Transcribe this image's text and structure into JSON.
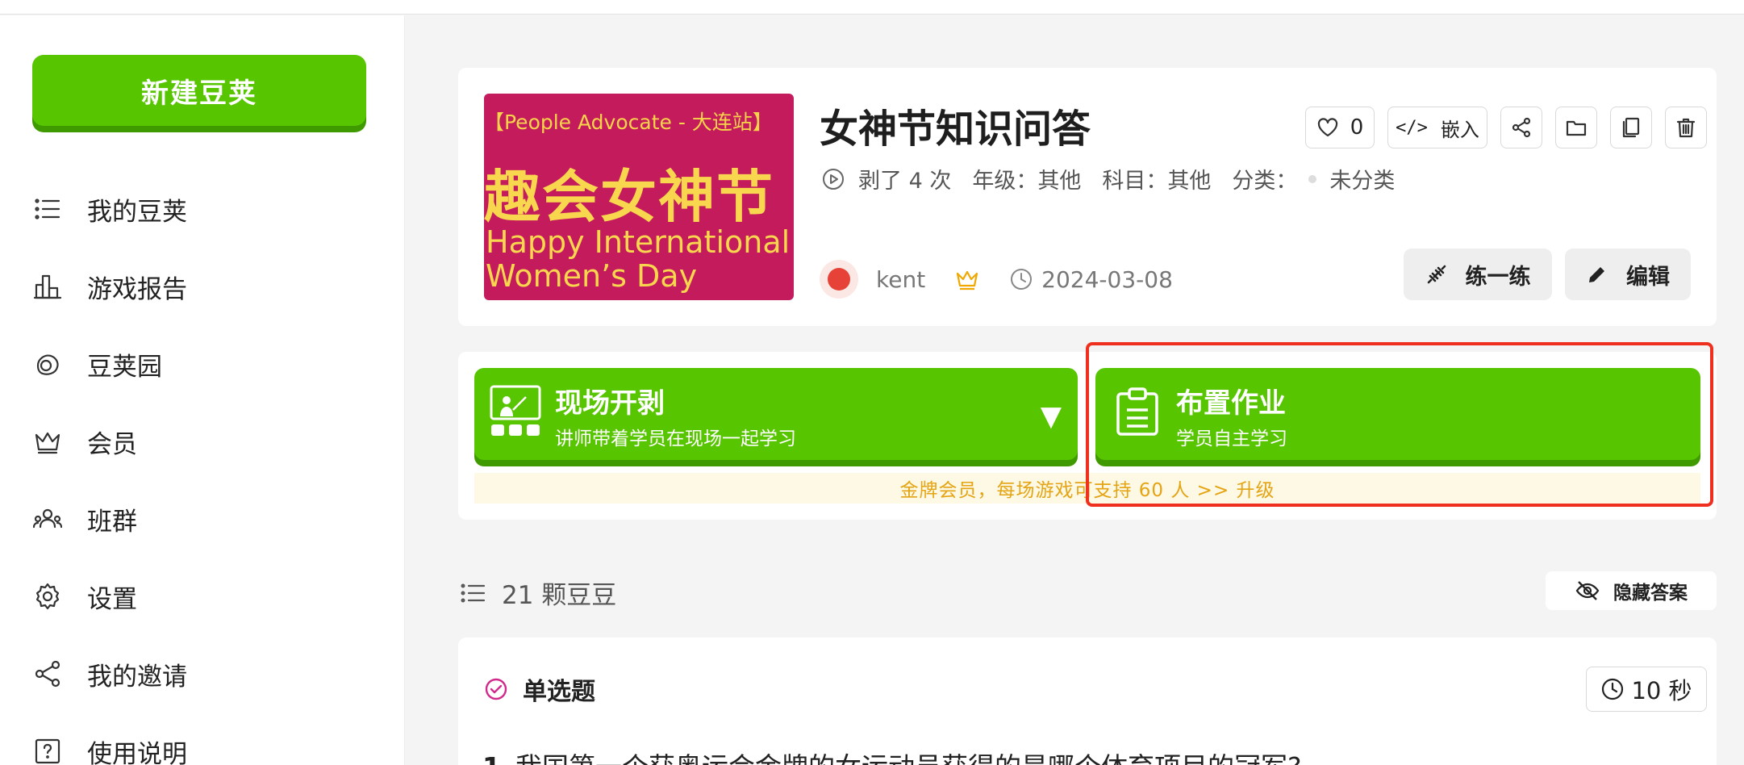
{
  "sidebar": {
    "new_button": "新建豆荚",
    "items": [
      {
        "label": "我的豆荚",
        "icon": "list-icon"
      },
      {
        "label": "游戏报告",
        "icon": "bar-chart-icon"
      },
      {
        "label": "豆荚园",
        "icon": "pod-garden-icon"
      },
      {
        "label": "会员",
        "icon": "crown-icon"
      },
      {
        "label": "班群",
        "icon": "group-icon"
      },
      {
        "label": "设置",
        "icon": "gear-icon"
      },
      {
        "label": "我的邀请",
        "icon": "share-icon"
      },
      {
        "label": "使用说明",
        "icon": "help-icon"
      }
    ]
  },
  "game": {
    "cover": {
      "line1": "【People Advocate - 大连站】",
      "line2": "趣会女神节",
      "line3": "Happy International",
      "line4": "Women’s Day"
    },
    "title": "女神节知识问答",
    "meta": {
      "plays": "剥了 4 次",
      "grade": "年级：其他",
      "subject": "科目：其他",
      "category_label": "分类：",
      "category": "未分类"
    },
    "likes": "0",
    "embed_code": "</>",
    "embed_label": "嵌入",
    "author": "kent",
    "date": "2024-03-08",
    "practice_button": "练一练",
    "edit_button": "编辑"
  },
  "play": {
    "live_title": "现场开剥",
    "live_sub": "讲师带着学员在现场一起学习",
    "live_caret": "▼",
    "homework_title": "布置作业",
    "homework_sub": "学员自主学习",
    "notice": "金牌会员，每场游戏可支持 60 人  >>  升级"
  },
  "questions": {
    "count": "21 颗豆豆",
    "hide_answers": "隐藏答案",
    "first": {
      "type": "单选题",
      "time": "10 秒",
      "number": "1",
      "text": "我国第一个获奥运会金牌的女运动员获得的是哪个体育项目的冠军?"
    }
  },
  "colors": {
    "brand_green": "#57c500",
    "highlight_red": "#f0301f",
    "notice_text": "#e4a414",
    "cover_bg": "#c41b5d"
  }
}
